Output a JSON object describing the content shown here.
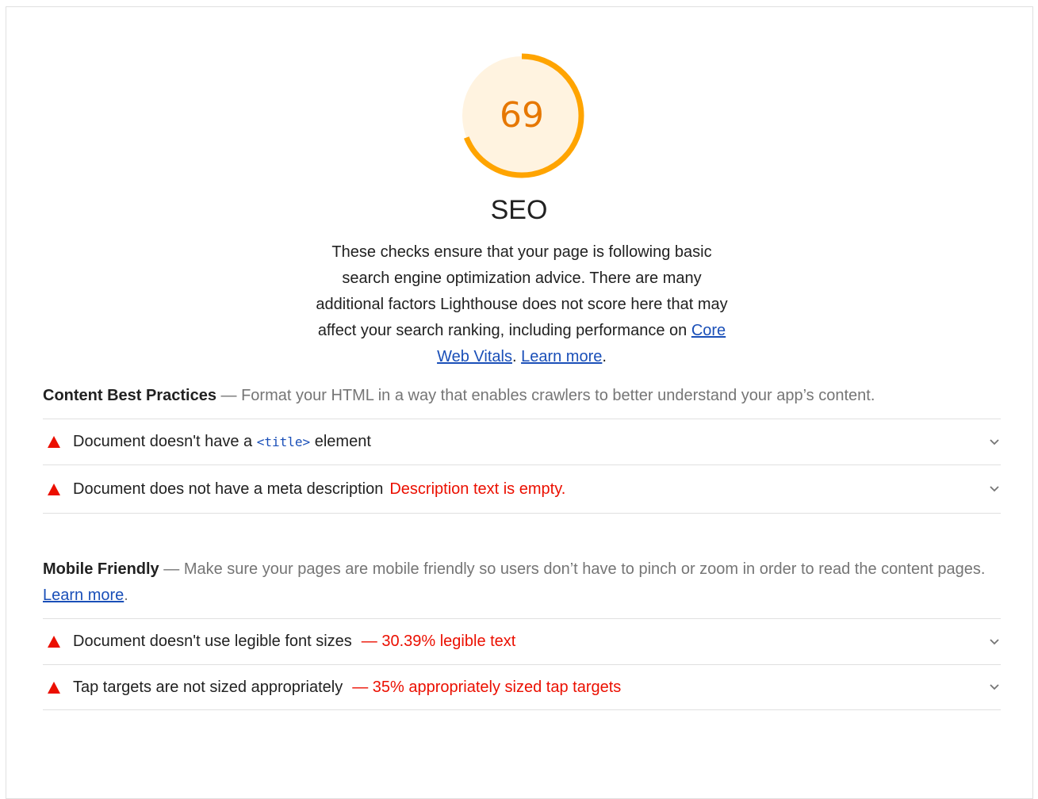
{
  "category": {
    "score": "69",
    "score_fraction": 0.69,
    "score_color": "#ffa400",
    "score_text_color": "#e67700",
    "score_bg_color": "#fff3e0",
    "title": "SEO",
    "description_prefix": "These checks ensure that your page is following basic search engine optimization advice. There are many additional factors Lighthouse does not score here that may affect your search ranking, including performance on ",
    "core_web_vitals_link": "Core Web Vitals",
    "description_sep": ". ",
    "learn_more_link": "Learn more",
    "description_end": "."
  },
  "groups": [
    {
      "title": "Content Best Practices",
      "separator": " — ",
      "description": "Format your HTML in a way that enables crawlers to better understand your app’s content.",
      "audits": [
        {
          "icon": "fail-triangle-icon",
          "title_before": "Document doesn't have a ",
          "code": "<title>",
          "title_after": " element",
          "extra": ""
        },
        {
          "icon": "fail-triangle-icon",
          "title": "Document does not have a meta description",
          "extra": "Description text is empty."
        }
      ]
    },
    {
      "title": "Mobile Friendly",
      "separator": " — ",
      "description": "Make sure your pages are mobile friendly so users don’t have to pinch or zoom in order to read the content pages. ",
      "learn_more_link": "Learn more",
      "description_end": ".",
      "audits": [
        {
          "icon": "fail-triangle-icon",
          "title": "Document doesn't use legible font sizes",
          "extra": "— 30.39% legible text"
        },
        {
          "icon": "fail-triangle-icon",
          "title": "Tap targets are not sized appropriately",
          "extra": "— 35% appropriately sized tap targets"
        }
      ]
    }
  ],
  "colors": {
    "fail": "#eb0f00",
    "link": "#1a4fb8",
    "divider": "#e0e0e0"
  }
}
